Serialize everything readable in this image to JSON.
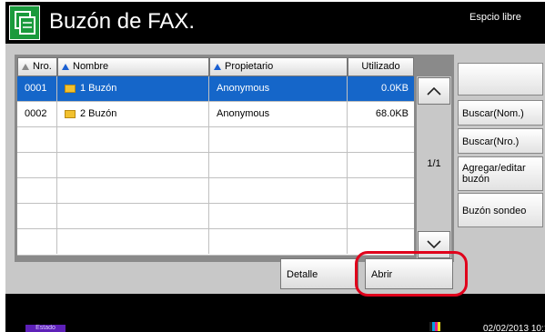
{
  "header": {
    "title": "Buzón de FAX.",
    "free_space_label": "Espcio libre",
    "icon": "fax-box-icon"
  },
  "table": {
    "columns": [
      "Nro.",
      "Nombre",
      "Propietario",
      "Utilizado"
    ],
    "rows": [
      {
        "nro": "0001",
        "nombre": "1  Buzón",
        "propietario": "Anonymous",
        "utilizado": "0.0KB",
        "selected": true
      },
      {
        "nro": "0002",
        "nombre": "2  Buzón",
        "propietario": "Anonymous",
        "utilizado": "68.0KB",
        "selected": false
      }
    ],
    "empty_row_count": 5,
    "page_indicator": "1/1"
  },
  "side_buttons": {
    "search_name": "Buscar(Nom.)",
    "search_number": "Buscar(Nro.)",
    "add_edit_line1": "Agregar/editar",
    "add_edit_line2": "buzón",
    "polling_box": "Buzón sondeo"
  },
  "bottom_buttons": {
    "detail": "Detalle",
    "open": "Abrir"
  },
  "status_bar": {
    "status_label": "Estado",
    "datetime": "02/02/2013 10:1"
  },
  "colors": {
    "selected_row": "#1566c9",
    "app_icon": "#1a9a3c",
    "highlight_ring": "#e0001b",
    "status_label": "#5d20b8"
  }
}
